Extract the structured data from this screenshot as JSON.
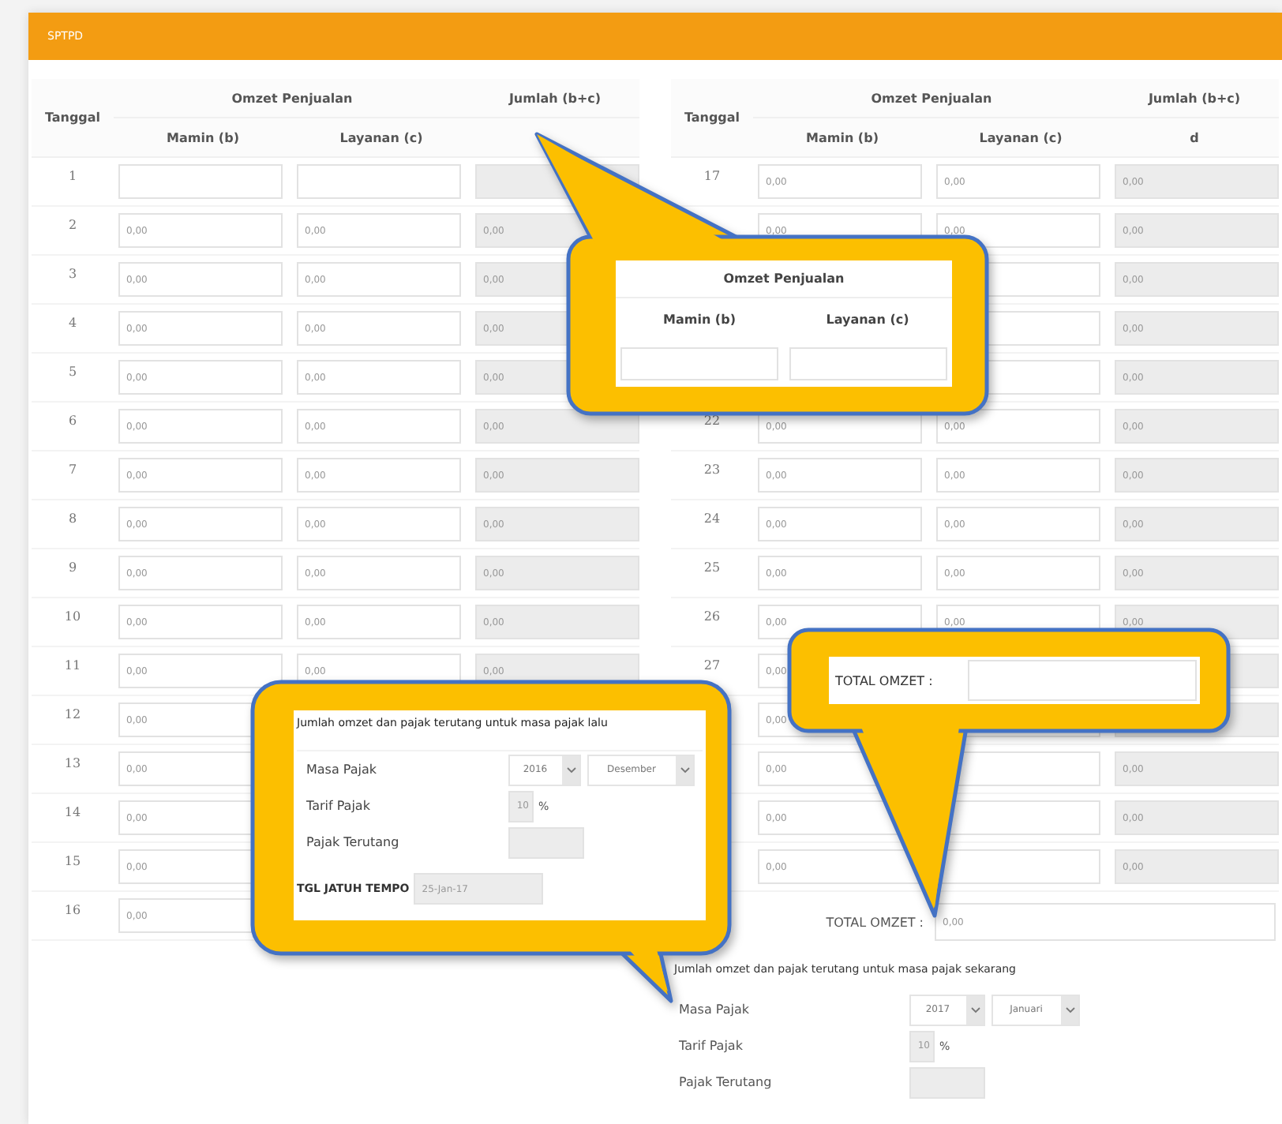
{
  "header": {
    "title": "SPTPD"
  },
  "tables": [
    {
      "col_date": "Tanggal",
      "group_heading": "Omzet Penjualan",
      "col_total": "Jumlah (b+c)",
      "sub_b": "Mamin (b)",
      "sub_c": "Layanan (c)",
      "rows": [
        {
          "day": "1"
        },
        {
          "day": "2",
          "b": "0,00",
          "c": "0,00",
          "d": "0,00"
        },
        {
          "day": "3",
          "b": "0,00",
          "c": "0,00",
          "d": "0,00"
        },
        {
          "day": "4",
          "b": "0,00",
          "c": "0,00",
          "d": "0,00"
        },
        {
          "day": "5",
          "b": "0,00",
          "c": "0,00",
          "d": "0,00"
        },
        {
          "day": "6",
          "b": "0,00",
          "c": "0,00",
          "d": "0,00"
        },
        {
          "day": "7",
          "b": "0,00",
          "c": "0,00",
          "d": "0,00"
        },
        {
          "day": "8",
          "b": "0,00",
          "c": "0,00",
          "d": "0,00"
        },
        {
          "day": "9",
          "b": "0,00",
          "c": "0,00",
          "d": "0,00"
        },
        {
          "day": "10",
          "b": "0,00",
          "c": "0,00",
          "d": "0,00"
        },
        {
          "day": "11",
          "b": "0,00",
          "c": "0,00",
          "d": "0,00"
        },
        {
          "day": "12",
          "b": "0,00"
        },
        {
          "day": "13",
          "b": "0,00"
        },
        {
          "day": "14",
          "b": "0,00"
        },
        {
          "day": "15",
          "b": "0,00"
        },
        {
          "day": "16",
          "b": "0,00"
        }
      ]
    },
    {
      "col_date": "Tanggal",
      "group_heading": "Omzet Penjualan",
      "col_total": "Jumlah (b+c)",
      "sub_b": "Mamin (b)",
      "sub_c": "Layanan (c)",
      "sub_d": "d",
      "rows": [
        {
          "day": "17",
          "b": "0,00",
          "c": "0,00",
          "d": "0,00"
        },
        {
          "b": "0,00",
          "c": "0,00",
          "d": "0,00"
        },
        {
          "d": "0,00"
        },
        {
          "d": "0,00"
        },
        {
          "d": "0,00"
        },
        {
          "day": "22",
          "b": "0,00",
          "c": "0,00",
          "d": "0,00"
        },
        {
          "day": "23",
          "b": "0,00",
          "c": "0,00",
          "d": "0,00"
        },
        {
          "day": "24",
          "b": "0,00",
          "c": "0,00",
          "d": "0,00"
        },
        {
          "day": "25",
          "b": "0,00",
          "c": "0,00",
          "d": "0,00"
        },
        {
          "day": "26",
          "b": "0,00",
          "c": "0,00",
          "d": "0,00"
        },
        {
          "day": "27",
          "b": "0,00"
        },
        {
          "b": "0,00"
        },
        {
          "b": "0,00",
          "d": "0,00"
        },
        {
          "b": "0,00",
          "d": "0,00"
        },
        {
          "b": "0,00",
          "d": "0,00"
        }
      ]
    }
  ],
  "total": {
    "label": "TOTAL OMZET :",
    "value": "0,00"
  },
  "current_period": {
    "title": "Jumlah omzet dan pajak terutang untuk masa pajak sekarang",
    "masa_label": "Masa Pajak",
    "year": "2017",
    "month": "Januari",
    "tarif_label": "Tarif Pajak",
    "tarif": "10",
    "percent": "%",
    "terutang_label": "Pajak Terutang"
  },
  "callouts": [
    {
      "kind": "table_header",
      "group_heading": "Omzet Penjualan",
      "sub_b": "Mamin (b)",
      "sub_c": "Layanan (c)"
    },
    {
      "kind": "previous_period",
      "title": "Jumlah omzet dan pajak terutang untuk masa pajak lalu",
      "masa_label": "Masa Pajak",
      "year": "2016",
      "month": "Desember",
      "tarif_label": "Tarif Pajak",
      "tarif": "10",
      "percent": "%",
      "terutang_label": "Pajak Terutang",
      "due_label": "TGL JATUH TEMPO",
      "due_date": "25-Jan-17"
    },
    {
      "kind": "total",
      "label": "TOTAL OMZET :"
    }
  ]
}
